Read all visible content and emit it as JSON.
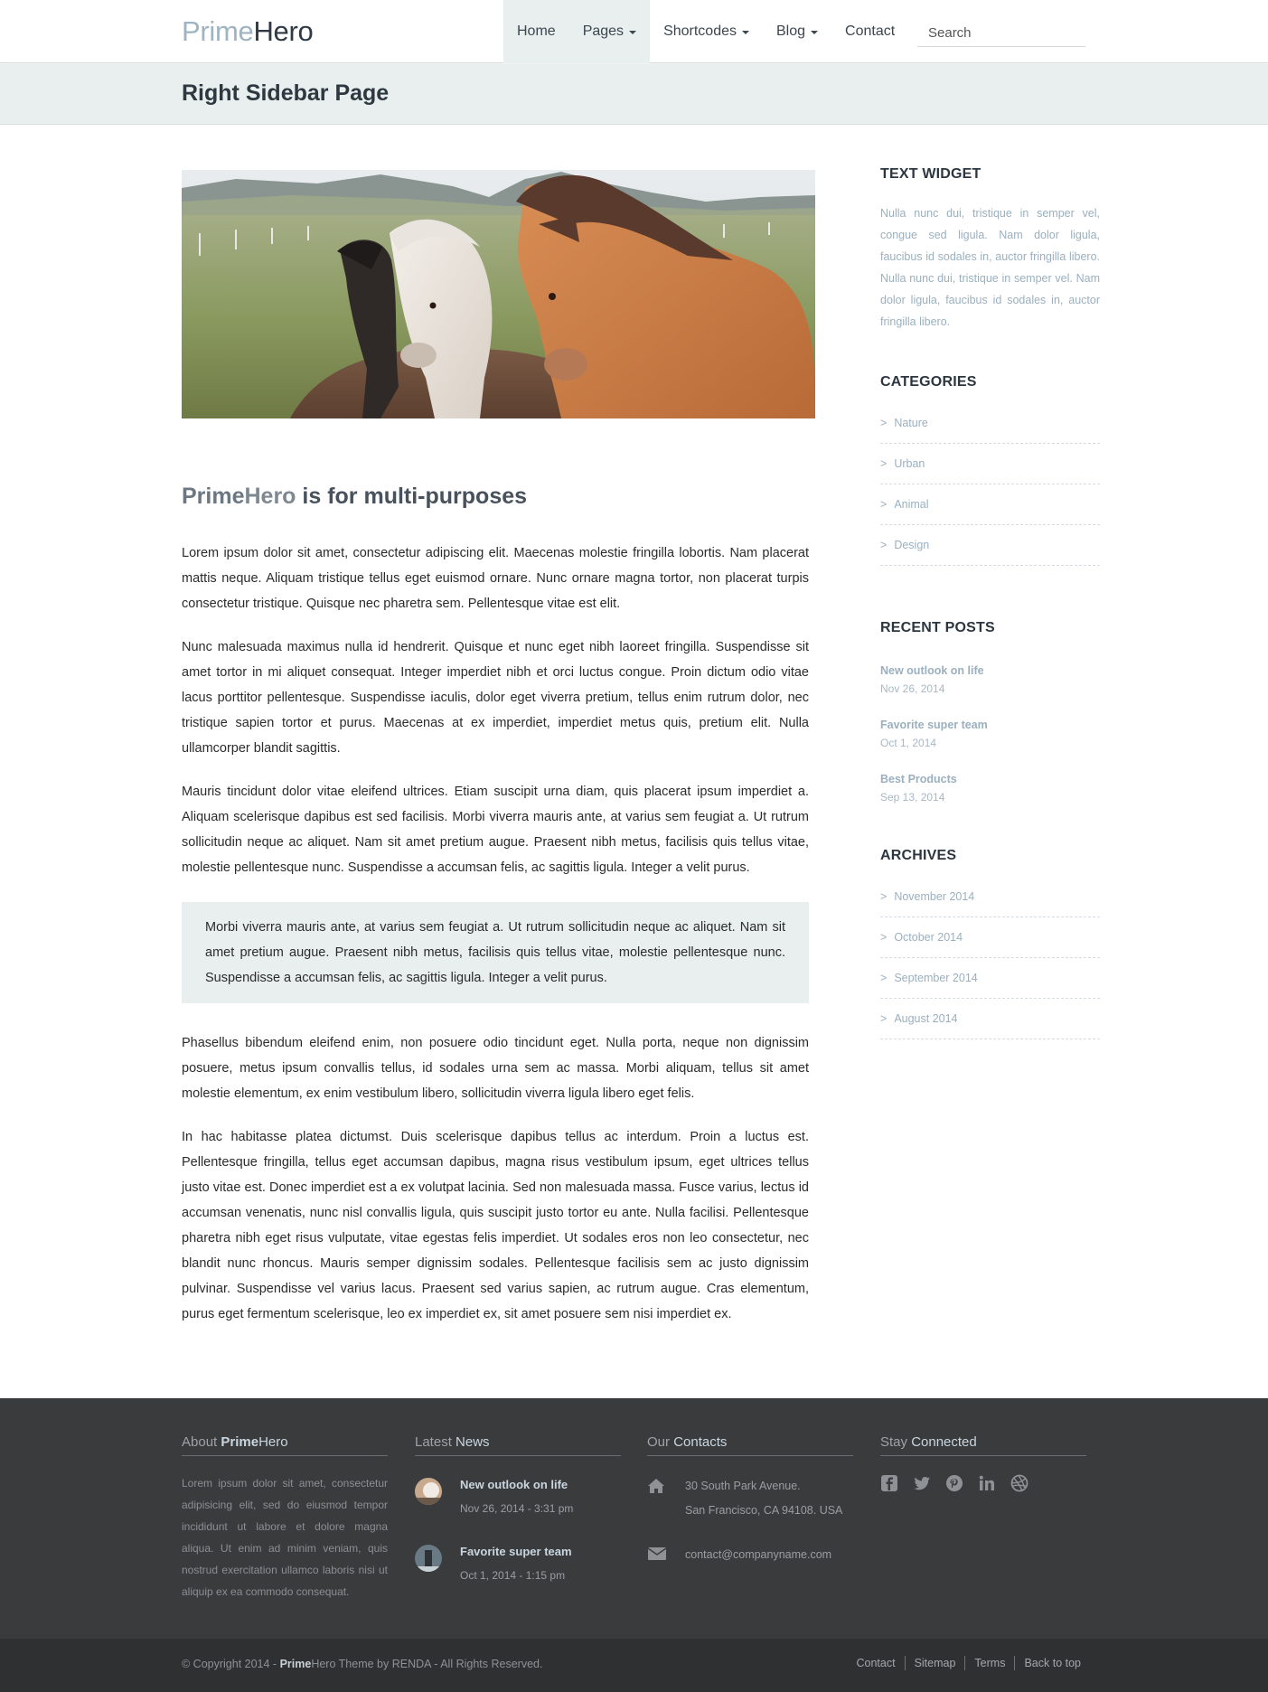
{
  "brand": {
    "part1": "Prime",
    "part2": "Hero"
  },
  "nav": {
    "items": [
      {
        "label": "Home"
      },
      {
        "label": "Pages"
      },
      {
        "label": "Shortcodes"
      },
      {
        "label": "Blog"
      },
      {
        "label": "Contact"
      }
    ],
    "search_placeholder": "Search"
  },
  "page_title": "Right Sidebar Page",
  "article": {
    "heading_brand1": "Prime",
    "heading_brand2": "Hero",
    "heading_rest": " is for multi-purposes",
    "paragraphs": [
      "Lorem ipsum dolor sit amet, consectetur adipiscing elit. Maecenas molestie fringilla lobortis. Nam placerat mattis neque. Aliquam tristique tellus eget euismod ornare. Nunc ornare magna tortor, non placerat turpis consectetur tristique. Quisque nec pharetra sem. Pellentesque vitae est elit.",
      "Nunc malesuada maximus nulla id hendrerit. Quisque et nunc eget nibh laoreet fringilla. Suspendisse sit amet tortor in mi aliquet consequat. Integer imperdiet nibh et orci luctus congue. Proin dictum odio vitae lacus porttitor pellentesque. Suspendisse iaculis, dolor eget viverra pretium, tellus enim rutrum dolor, nec tristique sapien tortor et purus. Maecenas at ex imperdiet, imperdiet metus quis, pretium elit. Nulla ullamcorper blandit sagittis.",
      "Mauris tincidunt dolor vitae eleifend ultrices. Etiam suscipit urna diam, quis placerat ipsum imperdiet a. Aliquam scelerisque dapibus est sed facilisis. Morbi viverra mauris ante, at varius sem feugiat a. Ut rutrum sollicitudin neque ac aliquet. Nam sit amet pretium augue. Praesent nibh metus, facilisis quis tellus vitae, molestie pellentesque nunc. Suspendisse a accumsan felis, ac sagittis ligula. Integer a velit purus."
    ],
    "quote": "Morbi viverra mauris ante, at varius sem feugiat a. Ut rutrum sollicitudin neque ac aliquet. Nam sit amet pretium augue. Praesent nibh metus, facilisis quis tellus vitae, molestie pellentesque nunc. Suspendisse a accumsan felis, ac sagittis ligula. Integer a velit purus.",
    "paragraphs_after": [
      "Phasellus bibendum eleifend enim, non posuere odio tincidunt eget. Nulla porta, neque non dignissim posuere, metus ipsum convallis tellus, id sodales urna sem ac massa. Morbi aliquam, tellus sit amet molestie elementum, ex enim vestibulum libero, sollicitudin viverra ligula libero eget felis.",
      "In hac habitasse platea dictumst. Duis scelerisque dapibus tellus ac interdum. Proin a luctus est. Pellentesque fringilla, tellus eget accumsan dapibus, magna risus vestibulum ipsum, eget ultrices tellus justo vitae est. Donec imperdiet est a ex volutpat lacinia. Sed non malesuada massa. Fusce varius, lectus id accumsan venenatis, nunc nisl convallis ligula, quis suscipit justo tortor eu ante. Nulla facilisi. Pellentesque pharetra nibh eget risus vulputate, vitae egestas felis imperdiet. Ut sodales eros non leo consectetur, nec blandit nunc rhoncus. Mauris semper dignissim sodales. Pellentesque facilisis sem ac justo dignissim pulvinar. Suspendisse vel varius lacus. Praesent sed varius sapien, ac rutrum augue. Cras elementum, purus eget fermentum scelerisque, leo ex imperdiet ex, sit amet posuere sem nisi imperdiet ex."
    ]
  },
  "sidebar": {
    "text_widget": {
      "title": "TEXT WIDGET",
      "text": "Nulla nunc dui, tristique in semper vel, congue sed ligula. Nam dolor ligula, faucibus id sodales in, auctor fringilla libero. Nulla nunc dui, tristique in semper vel. Nam dolor ligula, faucibus id sodales in, auctor fringilla libero."
    },
    "categories": {
      "title": "CATEGORIES",
      "items": [
        "Nature",
        "Urban",
        "Animal",
        "Design"
      ]
    },
    "recent_posts": {
      "title": "RECENT POSTS",
      "items": [
        {
          "title": "New outlook on life",
          "date": "Nov 26, 2014"
        },
        {
          "title": "Favorite super team",
          "date": "Oct 1, 2014"
        },
        {
          "title": "Best Products",
          "date": "Sep 13, 2014"
        }
      ]
    },
    "archives": {
      "title": "ARCHIVES",
      "items": [
        "November 2014",
        "October 2014",
        "September 2014",
        "August 2014"
      ]
    }
  },
  "footer": {
    "about": {
      "title_pre": "About ",
      "title_b1": "Prime",
      "title_b2": "Hero",
      "text": "Lorem ipsum dolor sit amet, consectetur adipisicing elit, sed do eiusmod tempor incididunt ut labore et dolore magna aliqua. Ut enim ad minim veniam, quis nostrud exercitation ullamco laboris nisi ut aliquip ex ea commodo consequat."
    },
    "news": {
      "title_pre": "Latest ",
      "title_hl": "News",
      "items": [
        {
          "title": "New outlook on life",
          "date": "Nov 26, 2014 - 3:31 pm"
        },
        {
          "title": "Favorite super team",
          "date": "Oct 1, 2014 - 1:15 pm"
        }
      ]
    },
    "contacts": {
      "title_pre": "Our ",
      "title_hl": "Contacts",
      "address_line1": "30 South Park Avenue.",
      "address_line2": "San Francisco, CA 94108. USA",
      "email": "contact@companyname.com"
    },
    "social": {
      "title_pre": "Stay ",
      "title_hl": "Connected",
      "icons": [
        "facebook-icon",
        "twitter-icon",
        "pinterest-icon",
        "linkedin-icon",
        "dribbble-icon"
      ]
    }
  },
  "bottom": {
    "copy_pre": "© Copyright 2014 - ",
    "copy_b1": "Prime",
    "copy_b2": "Hero",
    "copy_post": " Theme by RENDA - All Rights Reserved.",
    "links": [
      "Contact",
      "Sitemap",
      "Terms",
      "Back to top"
    ]
  },
  "colors": {
    "accent": "#9fb4c2",
    "title_bg": "#e8efee",
    "footer_bg": "#3a3b3c",
    "bottom_bg": "#2f3031"
  }
}
